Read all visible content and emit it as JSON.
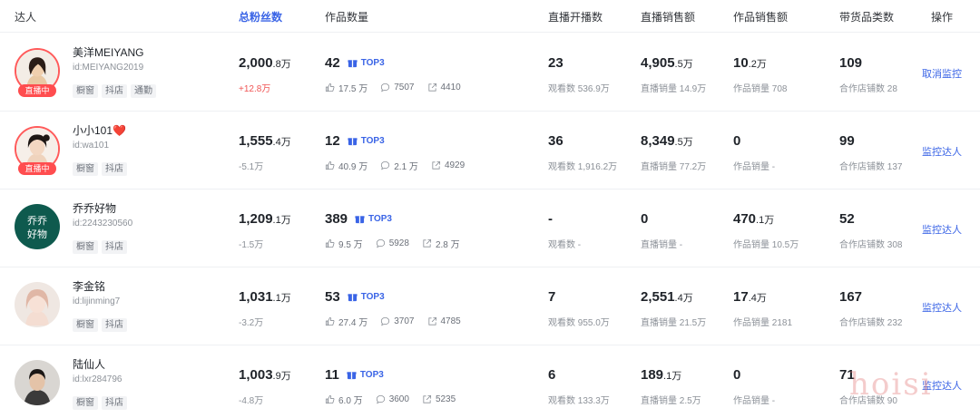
{
  "header": {
    "influencer": "达人",
    "total_fans": "总粉丝数",
    "works_count": "作品数量",
    "live_count": "直播开播数",
    "live_sales": "直播销售额",
    "works_sales": "作品销售额",
    "categories": "带货品类数",
    "action": "操作"
  },
  "rows": [
    {
      "name": "美洋MEIYANG",
      "uid": "id:MEIYANG2019",
      "live_badge": "直播中",
      "tags": [
        "橱窗",
        "抖店",
        "通勤"
      ],
      "fans_num": "2,000",
      "fans_unit": ".8万",
      "fans_change": "+12.8万",
      "works_num": "42",
      "top3": "TOP3",
      "likes": "17.5 万",
      "comments": "7507",
      "shares": "4410",
      "live_num": "23",
      "live_unit": "",
      "live_sub": "观看数 536.9万",
      "lsales_num": "4,905",
      "lsales_unit": ".5万",
      "lsales_sub": "直播销量 14.9万",
      "wsales_num": "10",
      "wsales_unit": ".2万",
      "wsales_sub": "作品销量 708",
      "cat_num": "109",
      "cat_sub": "合作店铺数 28",
      "action": "取消监控"
    },
    {
      "name": "小小101❤️",
      "uid": "id:wa101",
      "live_badge": "直播中",
      "tags": [
        "橱窗",
        "抖店"
      ],
      "fans_num": "1,555",
      "fans_unit": ".4万",
      "fans_change": "-5.1万",
      "works_num": "12",
      "top3": "TOP3",
      "likes": "40.9 万",
      "comments": "2.1 万",
      "shares": "4929",
      "live_num": "36",
      "live_unit": "",
      "live_sub": "观看数 1,916.2万",
      "lsales_num": "8,349",
      "lsales_unit": ".5万",
      "lsales_sub": "直播销量 77.2万",
      "wsales_num": "0",
      "wsales_unit": "",
      "wsales_sub": "作品销量 -",
      "cat_num": "99",
      "cat_sub": "合作店铺数 137",
      "action": "监控达人"
    },
    {
      "name": "乔乔好物",
      "uid": "id:2243230560",
      "live_badge": "",
      "tags": [
        "橱窗",
        "抖店"
      ],
      "fans_num": "1,209",
      "fans_unit": ".1万",
      "fans_change": "-1.5万",
      "works_num": "389",
      "top3": "TOP3",
      "likes": "9.5 万",
      "comments": "5928",
      "shares": "2.8 万",
      "live_num": "-",
      "live_unit": "",
      "live_sub": "观看数 -",
      "lsales_num": "0",
      "lsales_unit": "",
      "lsales_sub": "直播销量 -",
      "wsales_num": "470",
      "wsales_unit": ".1万",
      "wsales_sub": "作品销量 10.5万",
      "cat_num": "52",
      "cat_sub": "合作店铺数 308",
      "action": "监控达人",
      "avatar_text": [
        "乔乔",
        "好物"
      ]
    },
    {
      "name": "李金铭",
      "uid": "id:lijinming7",
      "live_badge": "",
      "tags": [
        "橱窗",
        "抖店"
      ],
      "fans_num": "1,031",
      "fans_unit": ".1万",
      "fans_change": "-3.2万",
      "works_num": "53",
      "top3": "TOP3",
      "likes": "27.4 万",
      "comments": "3707",
      "shares": "4785",
      "live_num": "7",
      "live_unit": "",
      "live_sub": "观看数 955.0万",
      "lsales_num": "2,551",
      "lsales_unit": ".4万",
      "lsales_sub": "直播销量 21.5万",
      "wsales_num": "17",
      "wsales_unit": ".4万",
      "wsales_sub": "作品销量 2181",
      "cat_num": "167",
      "cat_sub": "合作店铺数 232",
      "action": "监控达人"
    },
    {
      "name": "陆仙人",
      "uid": "id:lxr284796",
      "live_badge": "",
      "tags": [
        "橱窗",
        "抖店"
      ],
      "fans_num": "1,003",
      "fans_unit": ".9万",
      "fans_change": "-4.8万",
      "works_num": "11",
      "top3": "TOP3",
      "likes": "6.0 万",
      "comments": "3600",
      "shares": "5235",
      "live_num": "6",
      "live_unit": "",
      "live_sub": "观看数 133.3万",
      "lsales_num": "189",
      "lsales_unit": ".1万",
      "lsales_sub": "直播销量 2.5万",
      "wsales_num": "0",
      "wsales_unit": "",
      "wsales_sub": "作品销量 -",
      "cat_num": "71",
      "cat_sub": "合作店铺数 90",
      "action": "监控达人"
    }
  ],
  "watermark": "hoisi",
  "colors": {
    "accent": "#3a64e6",
    "live": "#ff4d4f",
    "increase": "#f05454"
  }
}
